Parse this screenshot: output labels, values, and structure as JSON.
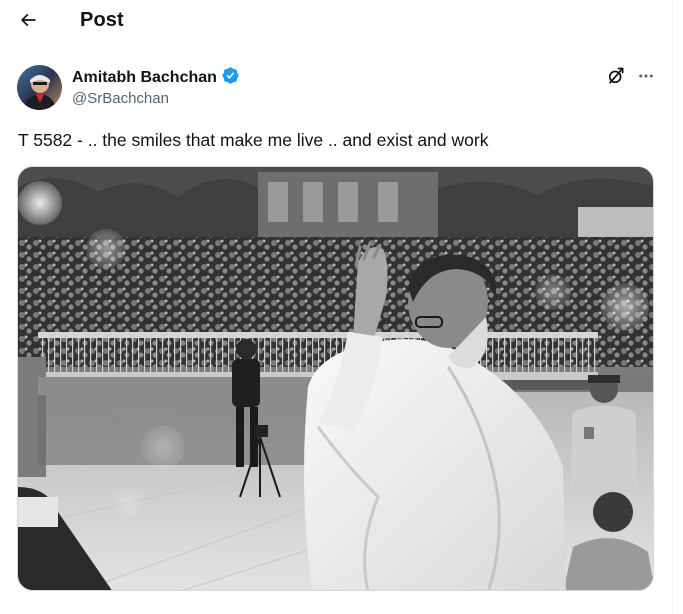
{
  "header": {
    "title": "Post",
    "back_icon": "arrow-left-icon"
  },
  "author": {
    "display_name": "Amitabh Bachchan",
    "handle": "@SrBachchan",
    "verified": true,
    "verified_color": "#1d9bf0",
    "avatar_icon": "user-avatar"
  },
  "actions": {
    "grok_icon": "grok-icon",
    "more_icon": "more-horizontal-icon"
  },
  "post": {
    "text": "T 5582 - .. the smiles that make me live .. and exist and work",
    "media_alt": "Black and white photo of a man in white kurta greeting a large crowd with folded hands from a gate"
  },
  "colors": {
    "text": "#0f1419",
    "secondary": "#536471",
    "accent": "#1d9bf0",
    "border": "#cfd9de"
  }
}
